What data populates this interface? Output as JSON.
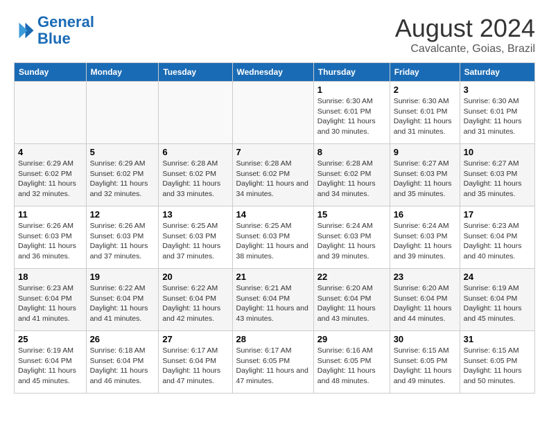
{
  "header": {
    "logo_line1": "General",
    "logo_line2": "Blue",
    "month": "August 2024",
    "location": "Cavalcante, Goias, Brazil"
  },
  "days_of_week": [
    "Sunday",
    "Monday",
    "Tuesday",
    "Wednesday",
    "Thursday",
    "Friday",
    "Saturday"
  ],
  "weeks": [
    [
      {
        "num": "",
        "info": ""
      },
      {
        "num": "",
        "info": ""
      },
      {
        "num": "",
        "info": ""
      },
      {
        "num": "",
        "info": ""
      },
      {
        "num": "1",
        "info": "Sunrise: 6:30 AM\nSunset: 6:01 PM\nDaylight: 11 hours and 30 minutes."
      },
      {
        "num": "2",
        "info": "Sunrise: 6:30 AM\nSunset: 6:01 PM\nDaylight: 11 hours and 31 minutes."
      },
      {
        "num": "3",
        "info": "Sunrise: 6:30 AM\nSunset: 6:01 PM\nDaylight: 11 hours and 31 minutes."
      }
    ],
    [
      {
        "num": "4",
        "info": "Sunrise: 6:29 AM\nSunset: 6:02 PM\nDaylight: 11 hours and 32 minutes."
      },
      {
        "num": "5",
        "info": "Sunrise: 6:29 AM\nSunset: 6:02 PM\nDaylight: 11 hours and 32 minutes."
      },
      {
        "num": "6",
        "info": "Sunrise: 6:28 AM\nSunset: 6:02 PM\nDaylight: 11 hours and 33 minutes."
      },
      {
        "num": "7",
        "info": "Sunrise: 6:28 AM\nSunset: 6:02 PM\nDaylight: 11 hours and 34 minutes."
      },
      {
        "num": "8",
        "info": "Sunrise: 6:28 AM\nSunset: 6:02 PM\nDaylight: 11 hours and 34 minutes."
      },
      {
        "num": "9",
        "info": "Sunrise: 6:27 AM\nSunset: 6:03 PM\nDaylight: 11 hours and 35 minutes."
      },
      {
        "num": "10",
        "info": "Sunrise: 6:27 AM\nSunset: 6:03 PM\nDaylight: 11 hours and 35 minutes."
      }
    ],
    [
      {
        "num": "11",
        "info": "Sunrise: 6:26 AM\nSunset: 6:03 PM\nDaylight: 11 hours and 36 minutes."
      },
      {
        "num": "12",
        "info": "Sunrise: 6:26 AM\nSunset: 6:03 PM\nDaylight: 11 hours and 37 minutes."
      },
      {
        "num": "13",
        "info": "Sunrise: 6:25 AM\nSunset: 6:03 PM\nDaylight: 11 hours and 37 minutes."
      },
      {
        "num": "14",
        "info": "Sunrise: 6:25 AM\nSunset: 6:03 PM\nDaylight: 11 hours and 38 minutes."
      },
      {
        "num": "15",
        "info": "Sunrise: 6:24 AM\nSunset: 6:03 PM\nDaylight: 11 hours and 39 minutes."
      },
      {
        "num": "16",
        "info": "Sunrise: 6:24 AM\nSunset: 6:03 PM\nDaylight: 11 hours and 39 minutes."
      },
      {
        "num": "17",
        "info": "Sunrise: 6:23 AM\nSunset: 6:04 PM\nDaylight: 11 hours and 40 minutes."
      }
    ],
    [
      {
        "num": "18",
        "info": "Sunrise: 6:23 AM\nSunset: 6:04 PM\nDaylight: 11 hours and 41 minutes."
      },
      {
        "num": "19",
        "info": "Sunrise: 6:22 AM\nSunset: 6:04 PM\nDaylight: 11 hours and 41 minutes."
      },
      {
        "num": "20",
        "info": "Sunrise: 6:22 AM\nSunset: 6:04 PM\nDaylight: 11 hours and 42 minutes."
      },
      {
        "num": "21",
        "info": "Sunrise: 6:21 AM\nSunset: 6:04 PM\nDaylight: 11 hours and 43 minutes."
      },
      {
        "num": "22",
        "info": "Sunrise: 6:20 AM\nSunset: 6:04 PM\nDaylight: 11 hours and 43 minutes."
      },
      {
        "num": "23",
        "info": "Sunrise: 6:20 AM\nSunset: 6:04 PM\nDaylight: 11 hours and 44 minutes."
      },
      {
        "num": "24",
        "info": "Sunrise: 6:19 AM\nSunset: 6:04 PM\nDaylight: 11 hours and 45 minutes."
      }
    ],
    [
      {
        "num": "25",
        "info": "Sunrise: 6:19 AM\nSunset: 6:04 PM\nDaylight: 11 hours and 45 minutes."
      },
      {
        "num": "26",
        "info": "Sunrise: 6:18 AM\nSunset: 6:04 PM\nDaylight: 11 hours and 46 minutes."
      },
      {
        "num": "27",
        "info": "Sunrise: 6:17 AM\nSunset: 6:04 PM\nDaylight: 11 hours and 47 minutes."
      },
      {
        "num": "28",
        "info": "Sunrise: 6:17 AM\nSunset: 6:05 PM\nDaylight: 11 hours and 47 minutes."
      },
      {
        "num": "29",
        "info": "Sunrise: 6:16 AM\nSunset: 6:05 PM\nDaylight: 11 hours and 48 minutes."
      },
      {
        "num": "30",
        "info": "Sunrise: 6:15 AM\nSunset: 6:05 PM\nDaylight: 11 hours and 49 minutes."
      },
      {
        "num": "31",
        "info": "Sunrise: 6:15 AM\nSunset: 6:05 PM\nDaylight: 11 hours and 50 minutes."
      }
    ]
  ]
}
